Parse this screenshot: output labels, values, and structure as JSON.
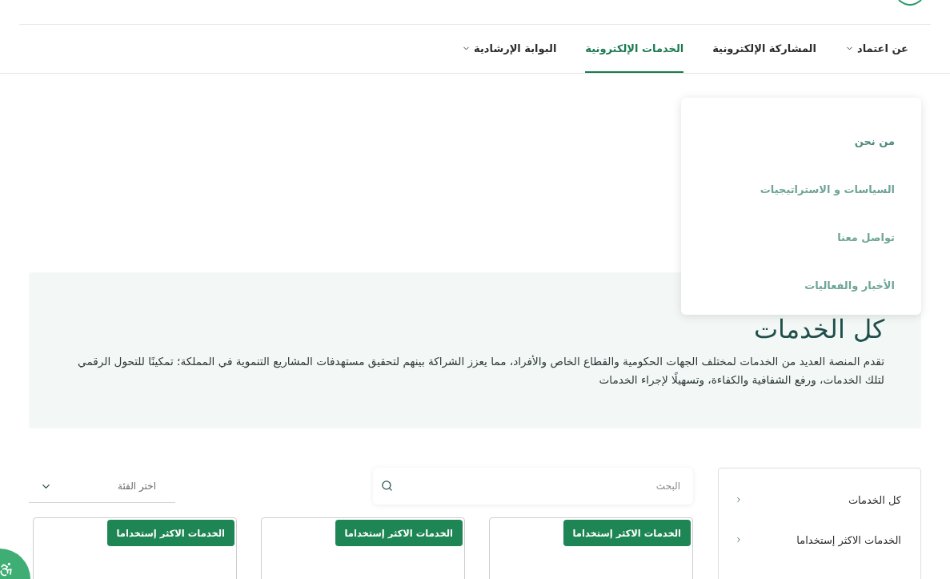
{
  "nav": {
    "items": [
      {
        "label": "عن اعتماد",
        "has_menu": true,
        "selected": false
      },
      {
        "label": "المشاركة الإلكترونية",
        "has_menu": false,
        "selected": false
      },
      {
        "label": "الخدمات الإلكترونية",
        "has_menu": false,
        "selected": true
      },
      {
        "label": "البوابة الإرشادية",
        "has_menu": true,
        "selected": false
      }
    ]
  },
  "dropdown": {
    "items": [
      {
        "label": "من نحن",
        "selected": true
      },
      {
        "label": "السياسات و الاستراتيجيات",
        "selected": false
      },
      {
        "label": "تواصل معنا",
        "selected": false
      },
      {
        "label": "الأخبار والفعاليات",
        "selected": false
      }
    ]
  },
  "hero": {
    "title": "كل الخدمات",
    "text": "تقدم المنصة العديد من الخدمات لمختلف الجهات الحكومية والقطاع الخاص والأفراد، مما يعزز الشراكة بينهم لتحقيق مستهدفات المشاريع التنموية في المملكة؛ تمكينًا للتحول الرقمي لتلك الخدمات، ورفع الشفافية والكفاءة، وتسهيلًا لإجراء الخدمات"
  },
  "sidebar": {
    "items": [
      {
        "label": "كل الخدمات"
      },
      {
        "label": "الخدمات الاكثر إستخداما"
      }
    ]
  },
  "search": {
    "placeholder": "البحث"
  },
  "category_select": {
    "placeholder": "اختر الفئة"
  },
  "cards": [
    {
      "badge": "الخدمات الاكثر إستخداما"
    },
    {
      "badge": "الخدمات الاكثر إستخداما"
    },
    {
      "badge": "الخدمات الاكثر إستخداما"
    }
  ]
}
